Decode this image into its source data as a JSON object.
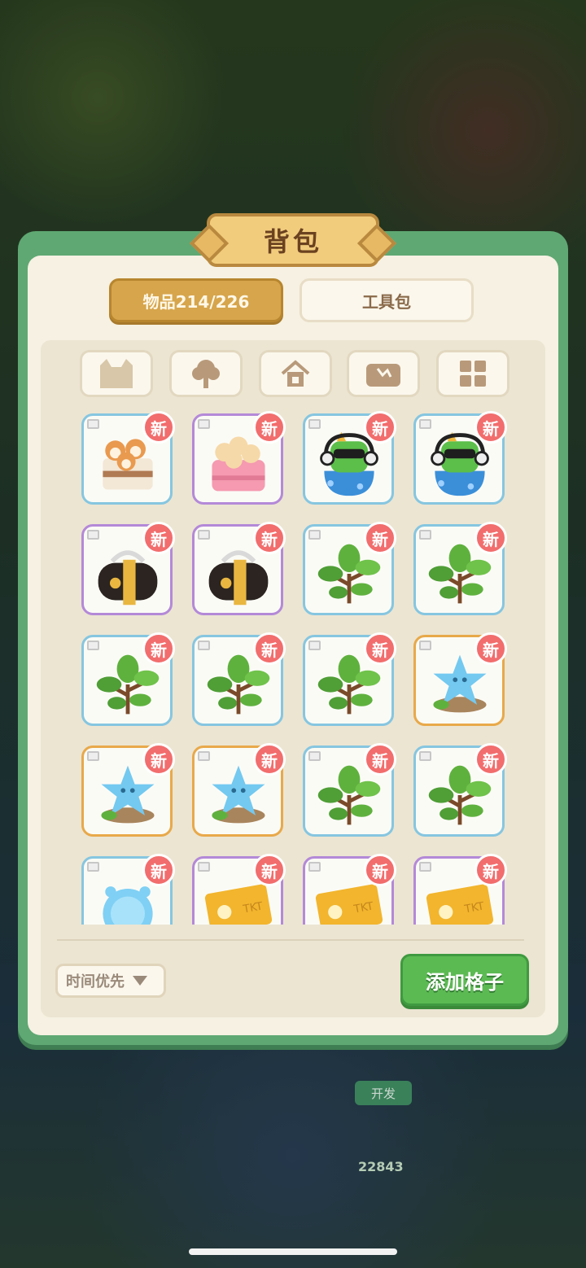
{
  "title": "背包",
  "tabs": [
    {
      "label": "物品214/226",
      "active": true
    },
    {
      "label": "工具包",
      "active": false
    }
  ],
  "filters": [
    {
      "icon": "cat-icon"
    },
    {
      "icon": "tree-icon"
    },
    {
      "icon": "house-icon"
    },
    {
      "icon": "treasure-chest-icon"
    },
    {
      "icon": "grid-icon"
    }
  ],
  "new_badge": "新",
  "items": [
    {
      "name": "shiba-cake",
      "rarity": "blue"
    },
    {
      "name": "pink-chick-basket",
      "rarity": "purple"
    },
    {
      "name": "dj-robot-cat",
      "rarity": "blue"
    },
    {
      "name": "dj-robot-cat",
      "rarity": "blue"
    },
    {
      "name": "black-gold-bag",
      "rarity": "purple"
    },
    {
      "name": "black-gold-bag",
      "rarity": "purple"
    },
    {
      "name": "green-plant",
      "rarity": "blue"
    },
    {
      "name": "green-plant",
      "rarity": "blue"
    },
    {
      "name": "green-plant",
      "rarity": "blue"
    },
    {
      "name": "green-plant",
      "rarity": "blue"
    },
    {
      "name": "green-plant",
      "rarity": "blue"
    },
    {
      "name": "star-sprite-stone",
      "rarity": "orange"
    },
    {
      "name": "star-sprite-stone",
      "rarity": "orange"
    },
    {
      "name": "star-sprite-stone",
      "rarity": "orange"
    },
    {
      "name": "green-plant",
      "rarity": "blue"
    },
    {
      "name": "green-plant",
      "rarity": "blue"
    },
    {
      "name": "blue-bubble-creature",
      "rarity": "blue"
    },
    {
      "name": "gold-ticket",
      "rarity": "purple"
    },
    {
      "name": "gold-ticket",
      "rarity": "purple"
    },
    {
      "name": "gold-ticket",
      "rarity": "purple"
    }
  ],
  "sort": {
    "label": "时间优先"
  },
  "add_slots_label": "添加格子",
  "background": {
    "dev_label": "开发",
    "count": "22843"
  },
  "colors": {
    "panel": "#5fa873",
    "tab_active": "#d6a54c",
    "add_button": "#5cba53",
    "badge": "#f26d6d"
  }
}
